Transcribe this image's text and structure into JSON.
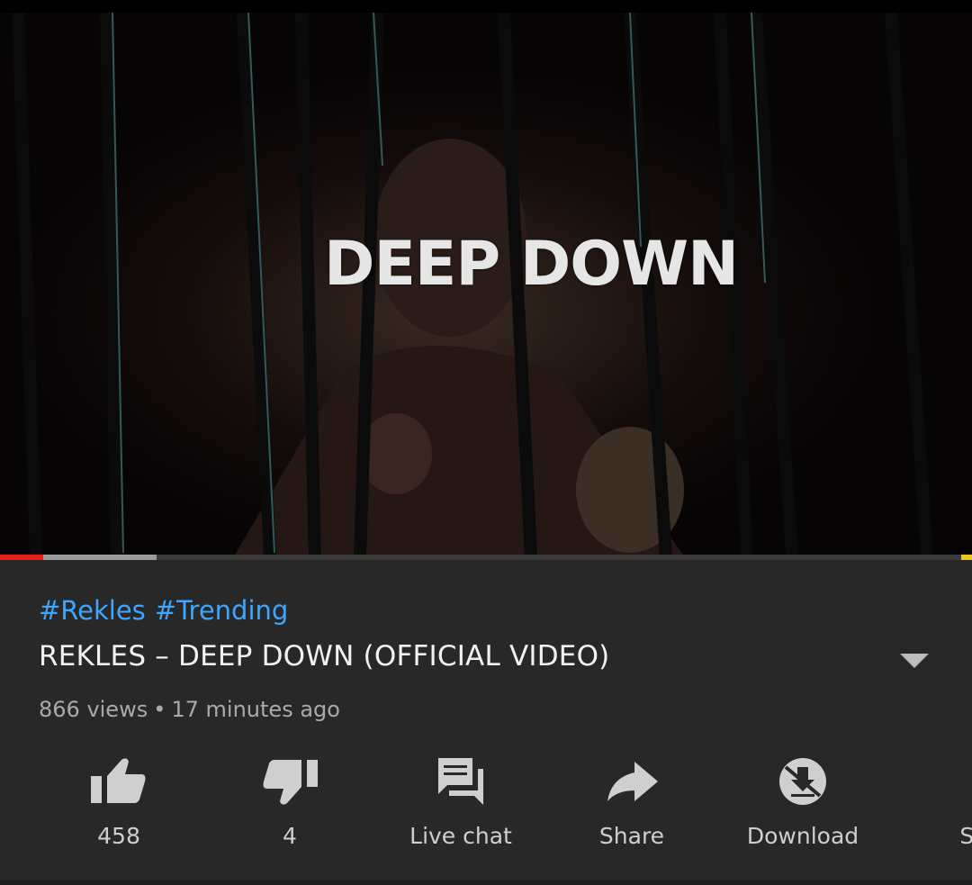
{
  "video": {
    "overlay_title": "DEEP DOWN",
    "progress_played_fraction": 0.044,
    "progress_buffered_fraction": 0.161
  },
  "details": {
    "hashtags": [
      "#Rekles",
      "#Trending"
    ],
    "title": "REKLES – DEEP DOWN (OFFICIAL VIDEO)",
    "views": "866 views",
    "separator": "•",
    "time_ago": "17 minutes ago"
  },
  "actions": [
    {
      "label": "458",
      "icon": "thumbs-up-icon"
    },
    {
      "label": "4",
      "icon": "thumbs-down-icon"
    },
    {
      "label": "Live chat",
      "icon": "live-chat-icon"
    },
    {
      "label": "Share",
      "icon": "share-icon"
    },
    {
      "label": "Download",
      "icon": "download-disabled-icon"
    },
    {
      "label": "Sa",
      "icon": "save-playlist-icon"
    }
  ],
  "colors": {
    "background": "#282828",
    "link": "#3ea6ff",
    "progress_played": "#e62117",
    "progress_buffered": "#9b9b9b",
    "icon": "#cfcfcf"
  }
}
